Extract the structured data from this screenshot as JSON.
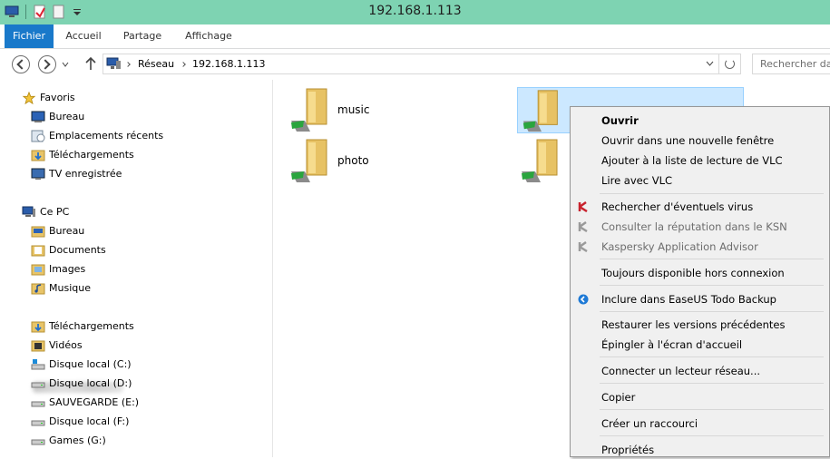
{
  "window": {
    "title": "192.168.1.113"
  },
  "ribbon": {
    "tabs": [
      "Fichier",
      "Accueil",
      "Partage",
      "Affichage"
    ]
  },
  "address": {
    "crumbs": [
      "Réseau",
      "192.168.1.113"
    ],
    "search_placeholder": "Rechercher dans"
  },
  "navpane": {
    "favorites_header": "Favoris",
    "favorites": [
      "Bureau",
      "Emplacements récents",
      "Téléchargements",
      "TV enregistrée"
    ],
    "pc_header": "Ce PC",
    "pc_items": [
      "Bureau",
      "Documents",
      "Images",
      "Musique",
      "Téléchargements",
      "Vidéos",
      "Disque local (C:)",
      "Disque local (D:)",
      "SAUVEGARDE (E:)",
      "Disque local (F:)",
      "Games (G:)"
    ]
  },
  "content": {
    "folders": [
      "music",
      "photo"
    ]
  },
  "context_menu": {
    "items": [
      "Ouvrir",
      "Ouvrir dans une nouvelle fenêtre",
      "Ajouter à la liste de lecture de VLC",
      "Lire avec VLC",
      "Rechercher d'éventuels virus",
      "Consulter la réputation dans le KSN",
      "Kaspersky Application Advisor",
      "Toujours disponible hors connexion",
      "Inclure dans EaseUS Todo Backup",
      "Restaurer les versions précédentes",
      "Épingler à l'écran d'accueil",
      "Connecter un lecteur réseau...",
      "Copier",
      "Créer un raccourci",
      "Propriétés"
    ]
  },
  "colors": {
    "titlebar": "#7ed3b2",
    "file_tab": "#1979ca",
    "selection": "#cce8ff",
    "folder": "#e8c468"
  }
}
